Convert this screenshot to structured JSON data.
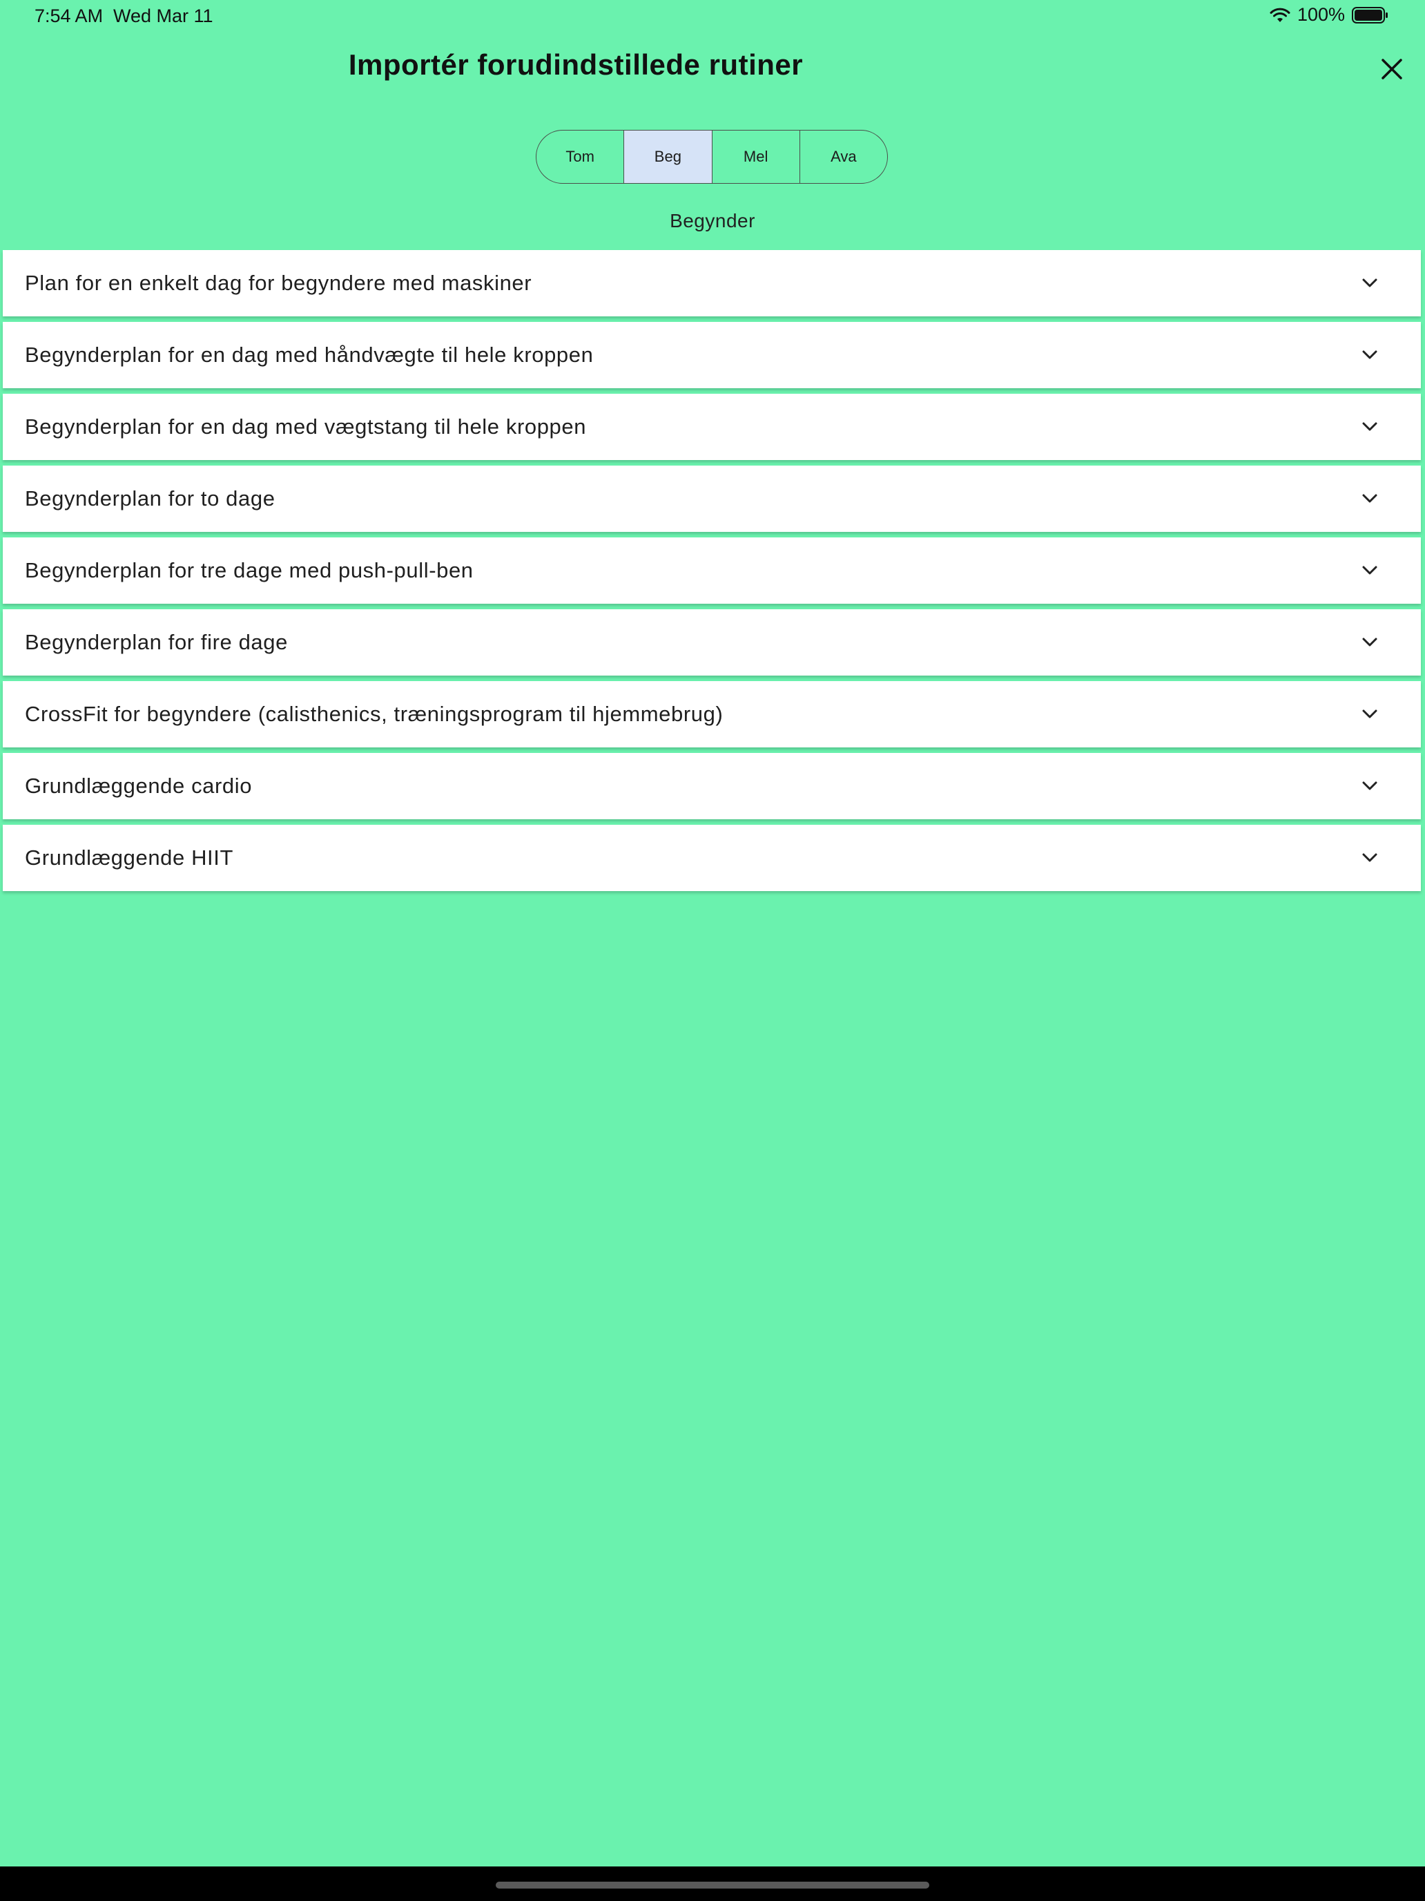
{
  "status_bar": {
    "time": "7:54 AM",
    "date": "Wed Mar 11",
    "battery": "100%"
  },
  "header": {
    "title": "Importér forudindstillede rutiner",
    "close_icon": "close-icon"
  },
  "segments": [
    {
      "label": "Tom",
      "selected": false
    },
    {
      "label": "Beg",
      "selected": true
    },
    {
      "label": "Mel",
      "selected": false
    },
    {
      "label": "Ava",
      "selected": false
    }
  ],
  "level_label": "Begynder",
  "routines": [
    {
      "label": "Plan for en enkelt dag for begyndere med maskiner"
    },
    {
      "label": "Begynderplan for en dag med håndvægte til hele kroppen"
    },
    {
      "label": "Begynderplan for en dag med vægtstang til hele kroppen"
    },
    {
      "label": "Begynderplan for to dage"
    },
    {
      "label": "Begynderplan for tre dage med push-pull-ben"
    },
    {
      "label": "Begynderplan for fire dage"
    },
    {
      "label": "CrossFit for begyndere (calisthenics, træningsprogram til hjemmebrug)"
    },
    {
      "label": "Grundlæggende cardio"
    },
    {
      "label": "Grundlæggende HIIT"
    }
  ],
  "colors": {
    "background": "#6af2ae",
    "selected_segment": "#d6e3f7",
    "card": "#ffffff"
  }
}
